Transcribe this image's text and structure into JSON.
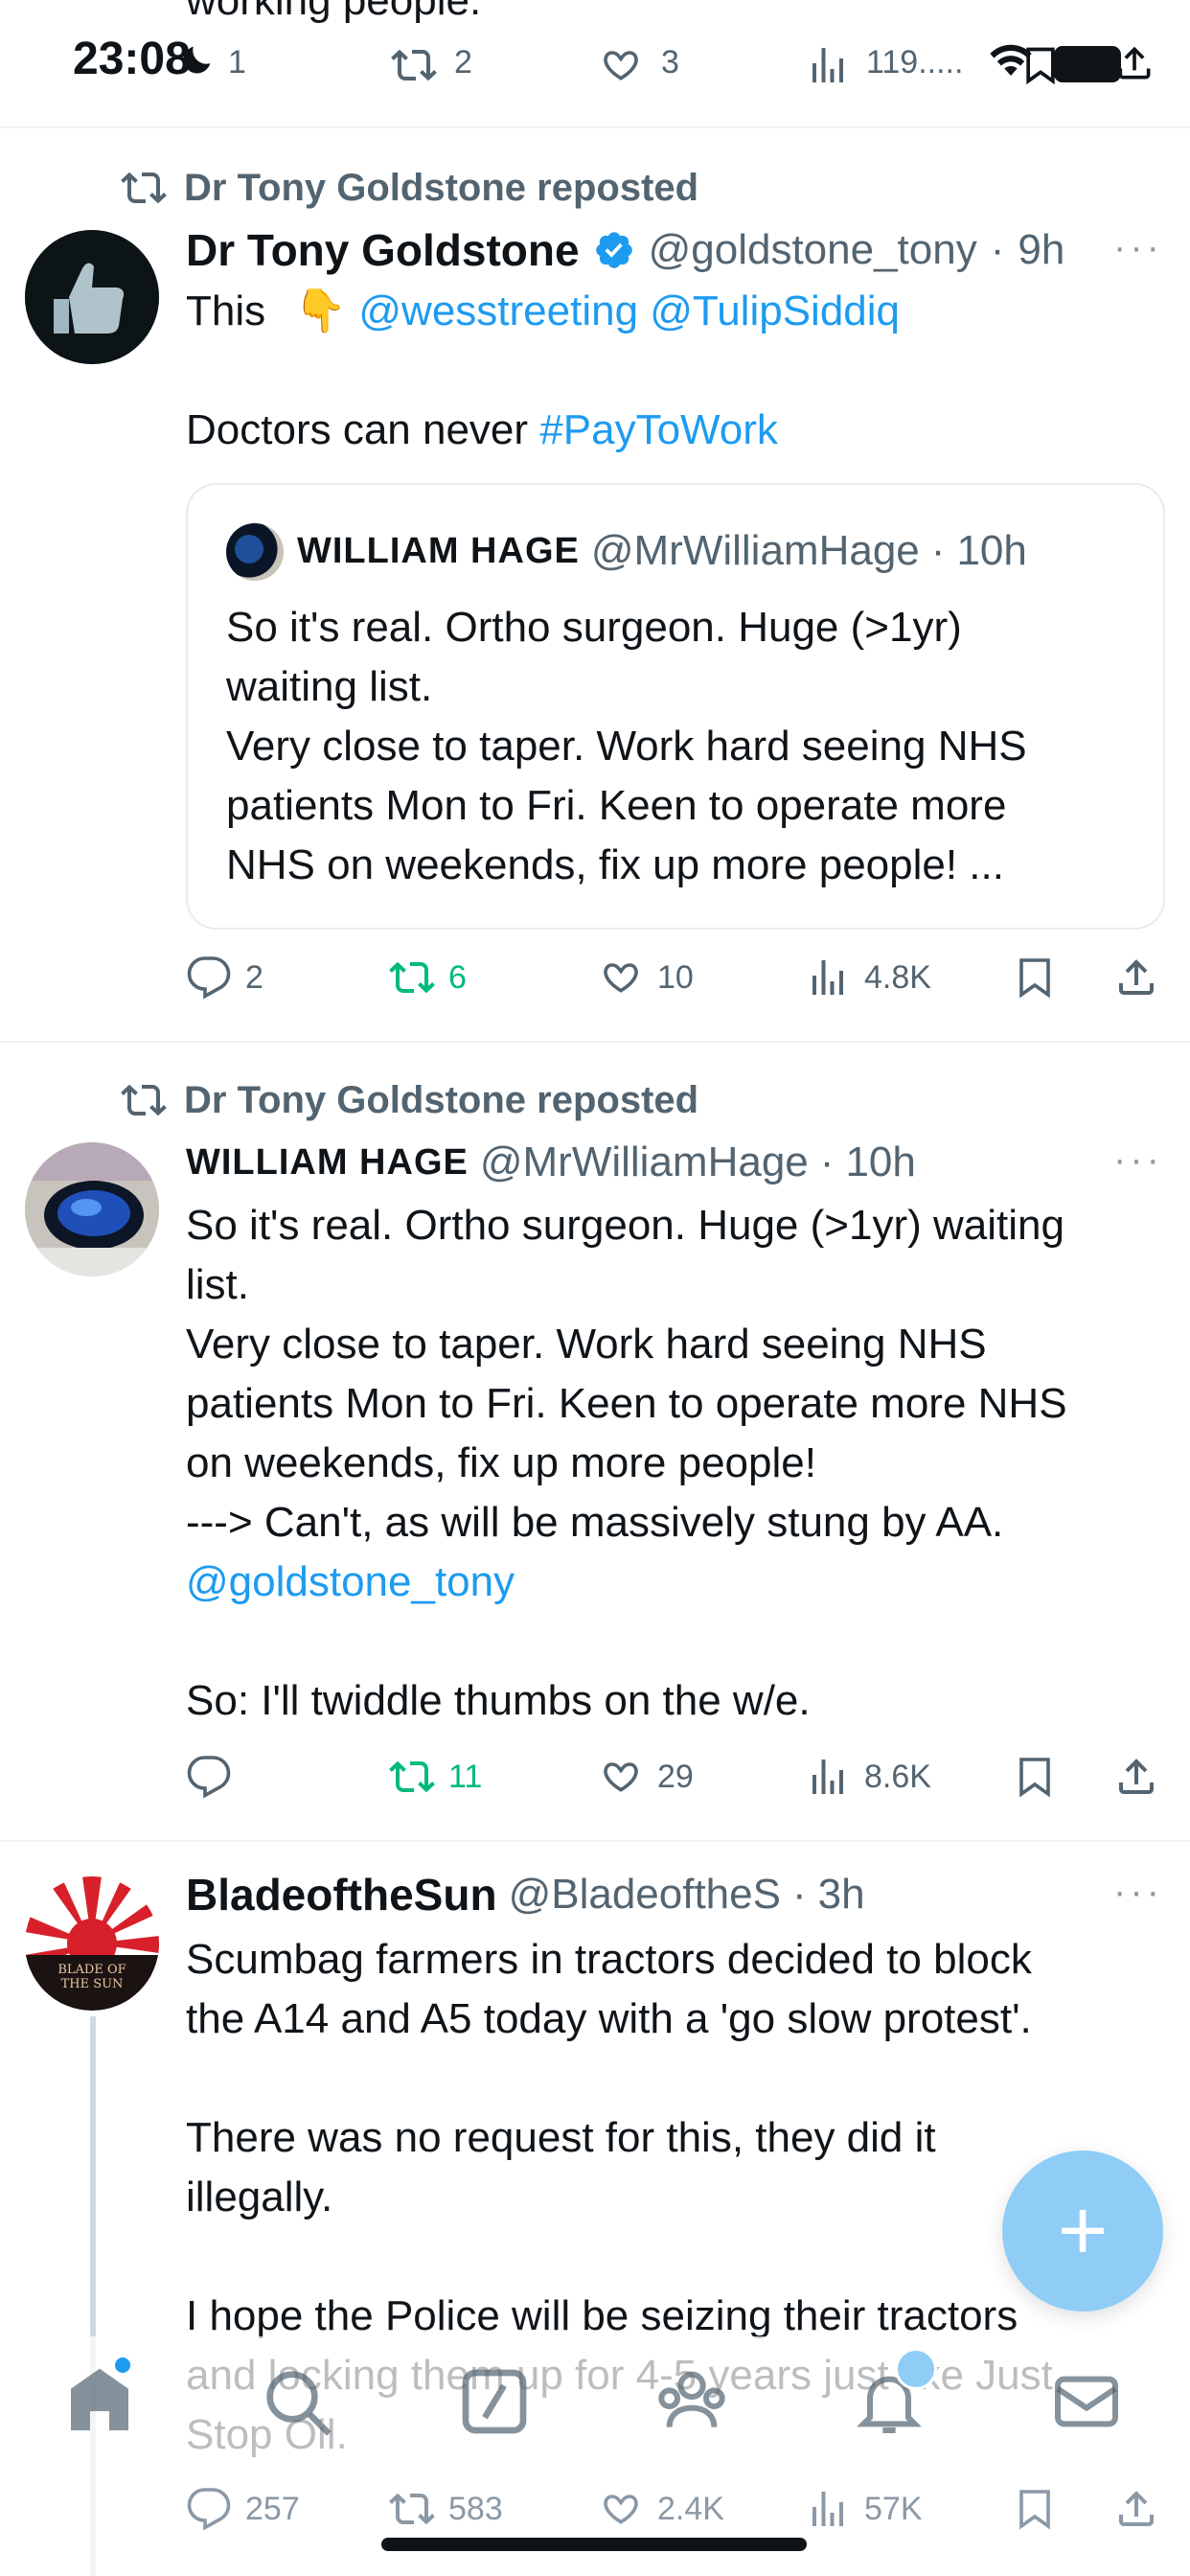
{
  "status_bar": {
    "time": "23:08"
  },
  "top_partial": {
    "text": "working people.",
    "reply_count": "1",
    "repost_count": "2",
    "like_count": "3",
    "view_count": "119....."
  },
  "posts": [
    {
      "repost_by": "Dr Tony Goldstone reposted",
      "author_name": "Dr Tony Goldstone",
      "verified": true,
      "handle": "@goldstone_tony",
      "dot": "·",
      "time": "9h",
      "text_prefix": "This",
      "emoji": "👇",
      "mention1": "@wesstreeting",
      "mention2": "@TulipSiddiq",
      "line2_prefix": "Doctors can never",
      "hashtag": "#PayToWork",
      "quote": {
        "author_name": "WILLIAM HAGE",
        "handle": "@MrWilliamHage",
        "dot": "·",
        "time": "10h",
        "text": "So it's real. Ortho surgeon. Huge (>1yr)\nwaiting list.\nVery close to taper. Work hard seeing NHS\npatients Mon to Fri. Keen to operate more\nNHS on weekends, fix up more people! ..."
      },
      "actions": {
        "replies": "2",
        "reposts": "6",
        "likes": "10",
        "views": "4.8K"
      }
    },
    {
      "repost_by": "Dr Tony Goldstone reposted",
      "author_name": "WILLIAM HAGE",
      "handle": "@MrWilliamHage",
      "dot": "·",
      "time": "10h",
      "text": "So it's real. Ortho surgeon. Huge (>1yr) waiting\nlist.\nVery close to taper. Work hard seeing NHS\npatients Mon to Fri. Keen to operate more NHS\non weekends, fix up more people!\n---> Can't, as will be massively stung by AA.",
      "mention": "@goldstone_tony",
      "text_end": "So: I'll twiddle thumbs on the w/e.",
      "actions": {
        "replies": "",
        "reposts": "11",
        "likes": "29",
        "views": "8.6K"
      }
    },
    {
      "author_name": "BladeoftheSun",
      "handle": "@BladeoftheS",
      "dot": "·",
      "time": "3h",
      "avatar_text": "BLADE OF THE SUN",
      "text": "Scumbag farmers in tractors decided to block\nthe A14 and A5 today with a 'go slow protest'.\n\nThere was no request for this, they did it\nillegally.\n\nI hope the Police will be seizing their tractors\nand locking them up for 4-5 years just like Just\nStop Oil.",
      "actions": {
        "replies": "257",
        "reposts": "583",
        "likes": "2.4K",
        "views": "57K"
      }
    }
  ],
  "more_icon": "···",
  "fab": {
    "icon": "plus-icon",
    "label": "+"
  },
  "tabbar": [
    "home-icon",
    "search-icon",
    "compose-grok-icon",
    "communities-icon",
    "notifications-icon",
    "messages-icon"
  ],
  "colors": {
    "accent": "#1d9bf0",
    "repost_green": "#00ba7c",
    "secondary": "#536471"
  }
}
